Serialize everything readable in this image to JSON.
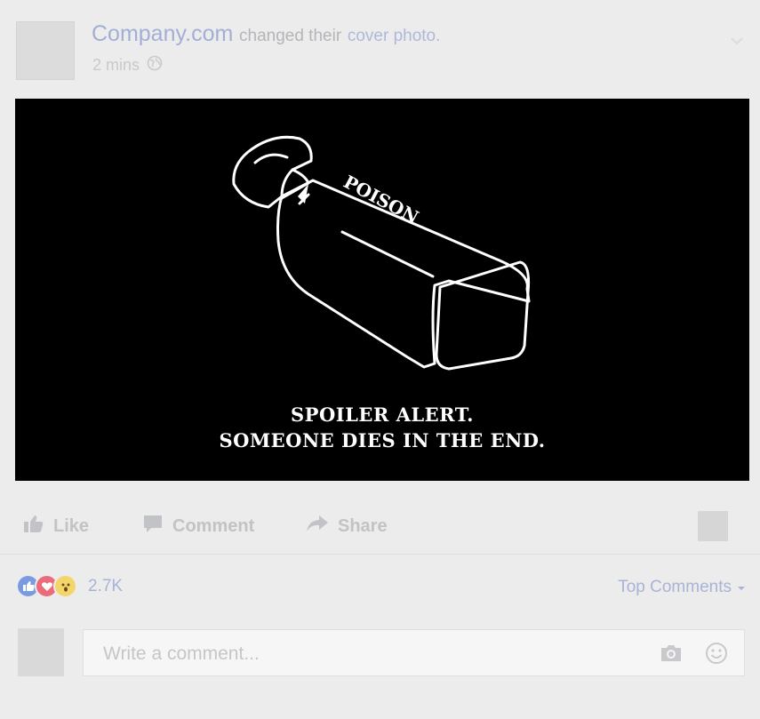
{
  "post": {
    "author": "Company.com",
    "action_text": "changed their",
    "action_link": "cover photo.",
    "time": "2 mins",
    "image": {
      "bottle_label": "POISON",
      "caption_line1": "SPOILER ALERT.",
      "caption_line2": "SOMEONE DIES IN THE END."
    }
  },
  "actions": {
    "like": "Like",
    "comment": "Comment",
    "share": "Share"
  },
  "reactions": {
    "types": [
      "like",
      "love",
      "wow"
    ],
    "count": "2.7K",
    "sort_label": "Top Comments"
  },
  "composer": {
    "placeholder": "Write a comment..."
  },
  "colors": {
    "link": "#a3aed6",
    "like": "#7b9be0",
    "love": "#ec6b7a",
    "wow": "#f3d66b"
  },
  "icons": [
    "globe-icon",
    "chevron-down-icon",
    "thumbs-up-icon",
    "comment-icon",
    "share-icon",
    "camera-icon",
    "smiley-icon"
  ]
}
